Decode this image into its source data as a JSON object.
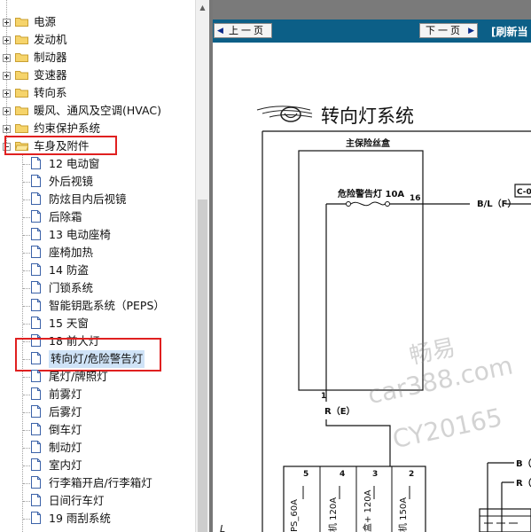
{
  "tree": {
    "folders_top": [
      "电源",
      "发动机",
      "制动器",
      "变速器",
      "转向系",
      "暖风、通风及空调(HVAC)",
      "约束保护系统",
      "车身及附件"
    ],
    "children": [
      "12 电动窗",
      "外后视镜",
      "防炫目内后视镜",
      "后除霜",
      "13 电动座椅",
      "座椅加热",
      "14 防盗",
      "门锁系统",
      "智能钥匙系统（PEPS）",
      "15 天窗",
      "18 前大灯",
      "转向灯/危险警告灯",
      "尾灯/牌照灯",
      "前雾灯",
      "后雾灯",
      "倒车灯",
      "制动灯",
      "室内灯",
      "行李箱开启/行李箱灯",
      "日间行车灯",
      "19 雨刮系统"
    ],
    "selected": "转向灯/危险警告灯",
    "highlighted_folder": "车身及附件"
  },
  "viewer": {
    "prev_label": "上一页",
    "next_label": "下一页",
    "refresh_label": "[刷新当",
    "toolbar_color": "#0c5f87"
  },
  "diagram": {
    "title": "转向灯系统",
    "fuse_box_label": "主保险丝盒",
    "fuse_label": "危险警告灯 10A",
    "pin_16": "16",
    "pin_1": "1",
    "wire_bl": "B/L（F）",
    "wire_re": "R（E）",
    "wire_b": "B（",
    "wire_r": "R（",
    "connector": "C-0",
    "pin_nums": [
      "5",
      "4",
      "3",
      "2"
    ],
    "fuse_row": [
      "PS_60A",
      "机 120A",
      "盒+ 120A",
      "机 150A"
    ],
    "left_mark": "L"
  },
  "watermark": {
    "line1": "畅易",
    "line2": "car388.com",
    "line3": "CY20165"
  },
  "icons": {
    "folder": "folder-icon",
    "document": "document-icon",
    "expander": "tree-expander-icon",
    "logo": "winged-logo-icon"
  }
}
